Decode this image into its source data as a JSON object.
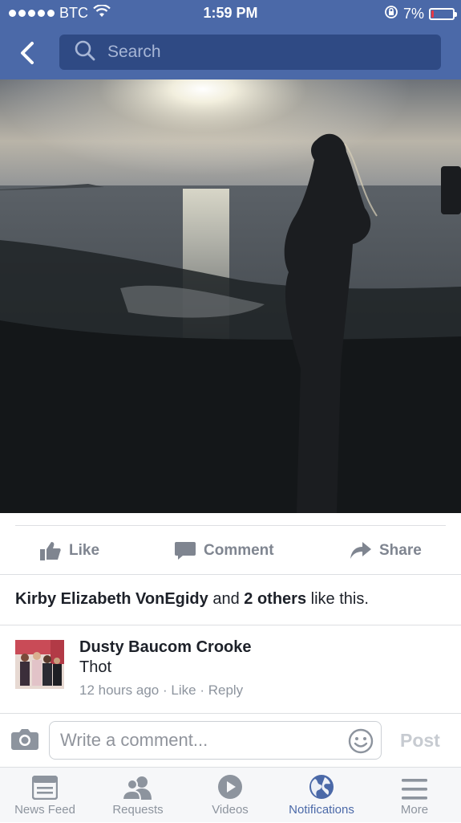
{
  "status_bar": {
    "carrier": "BTC",
    "time": "1:59 PM",
    "battery": "7%"
  },
  "header": {
    "search_placeholder": "Search"
  },
  "post_actions": {
    "like": "Like",
    "comment": "Comment",
    "share": "Share"
  },
  "likes_summary": {
    "name": "Kirby Elizabeth VonEgidy",
    "connector": "and",
    "others": "2 others",
    "suffix": "like this."
  },
  "comment": {
    "author": "Dusty Baucom Crooke",
    "text": "Thot",
    "time": "12 hours ago",
    "sep": "·",
    "like": "Like",
    "reply": "Reply"
  },
  "composer": {
    "placeholder": "Write a comment...",
    "post": "Post"
  },
  "tabbar": {
    "items": [
      {
        "label": "News Feed"
      },
      {
        "label": "Requests"
      },
      {
        "label": "Videos"
      },
      {
        "label": "Notifications"
      },
      {
        "label": "More"
      }
    ]
  },
  "colors": {
    "brand": "#4b69a8",
    "brand_dark": "#2f4a84",
    "inactive": "#8d949e"
  }
}
